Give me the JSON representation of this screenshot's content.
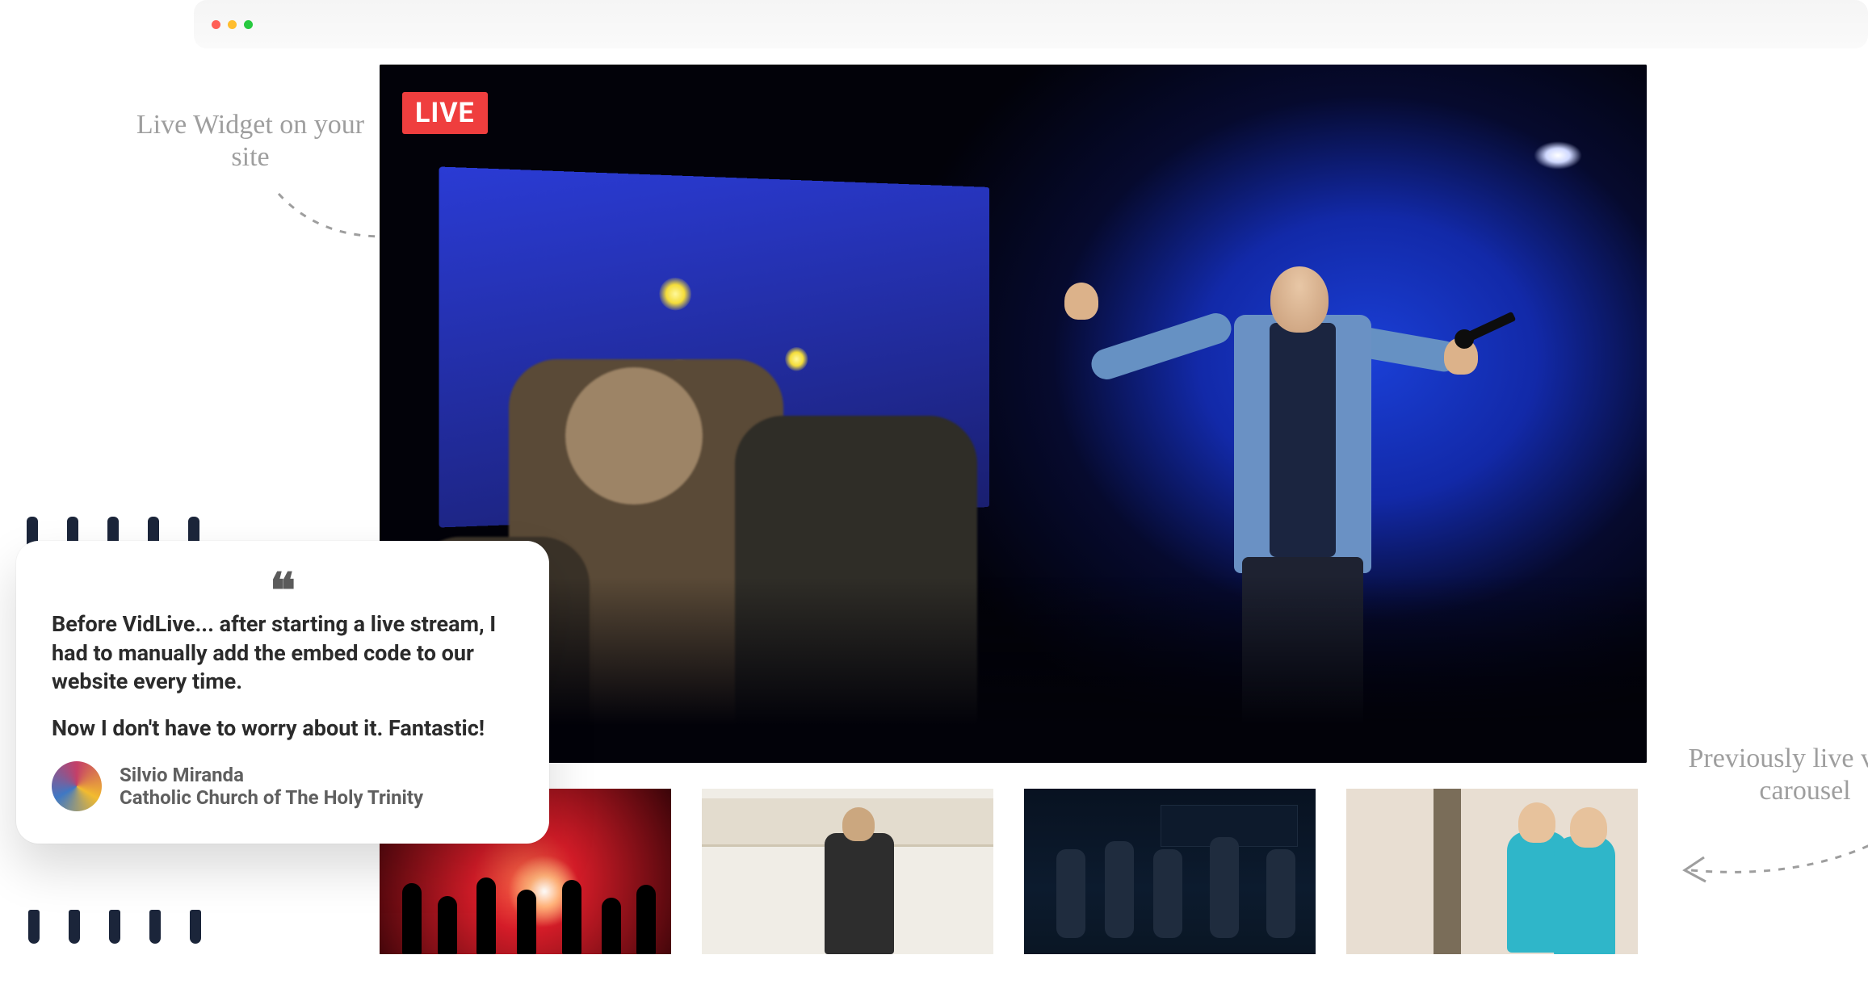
{
  "annotations": {
    "left": "Live Widget on your site",
    "right": "Previously live video carousel"
  },
  "live_badge": "LIVE",
  "testimonial": {
    "quote_part1": "Before VidLive... after starting a live stream, I had to manually add the embed code to our website every time.",
    "quote_part2": "Now I don't have to worry about it. Fantastic!",
    "author_name": "Silvio Miranda",
    "author_org": "Catholic Church of The Holy Trinity"
  },
  "colors": {
    "live_red": "#ef3e3e",
    "annotation_gray": "#9e9e9e"
  },
  "thumbnails": [
    {
      "id": "concert-red"
    },
    {
      "id": "bright-hall"
    },
    {
      "id": "worship-band"
    },
    {
      "id": "outdoor-volunteers"
    }
  ]
}
